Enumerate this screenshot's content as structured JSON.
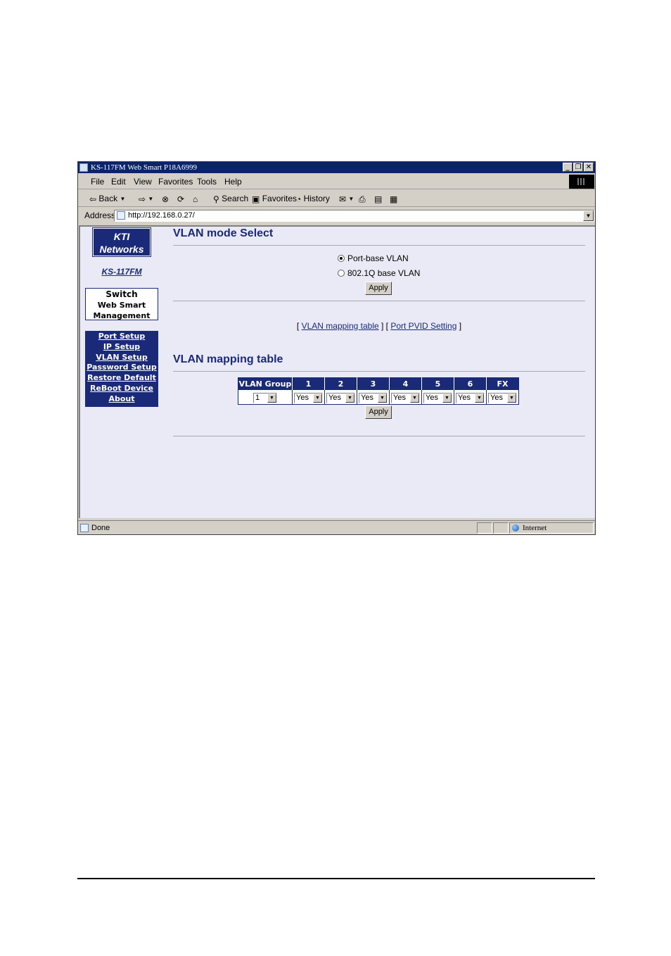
{
  "window": {
    "title": "KS-117FM Web Smart P18A6999",
    "buttons": {
      "minimize": "_",
      "restore": "❐",
      "close": "✕"
    }
  },
  "menu": [
    "File",
    "Edit",
    "View",
    "Favorites",
    "Tools",
    "Help"
  ],
  "toolbar": {
    "back": "Back",
    "search": "Search",
    "favorites": "Favorites",
    "history": "History"
  },
  "address": {
    "label": "Address",
    "value": "http://192.168.0.27/"
  },
  "sidebar": {
    "logo_line1": "KTI",
    "logo_line2": "Networks",
    "model": "KS-117FM",
    "box_line1": "Switch",
    "box_line2": "Web Smart",
    "box_line3": "Management",
    "nav": [
      "Port Setup",
      "IP Setup",
      "VLAN Setup",
      "Password Setup",
      "Restore Default",
      "ReBoot Device",
      "About"
    ]
  },
  "vlan_mode": {
    "title": "VLAN mode Select",
    "options": [
      {
        "label": "Port-base VLAN",
        "selected": true
      },
      {
        "label": "802.1Q base VLAN",
        "selected": false
      }
    ],
    "apply": "Apply"
  },
  "links": {
    "open1": "[ ",
    "link1": "VLAN mapping table",
    "mid": " ] [ ",
    "link2": "Port PVID Setting",
    "close": " ]"
  },
  "mapping": {
    "title": "VLAN mapping table",
    "headers": [
      "VLAN Group",
      "1",
      "2",
      "3",
      "4",
      "5",
      "6",
      "FX"
    ],
    "group_value": "1",
    "values": [
      "Yes",
      "Yes",
      "Yes",
      "Yes",
      "Yes",
      "Yes",
      "Yes"
    ],
    "apply": "Apply"
  },
  "status": {
    "text": "Done",
    "zone": "Internet"
  }
}
